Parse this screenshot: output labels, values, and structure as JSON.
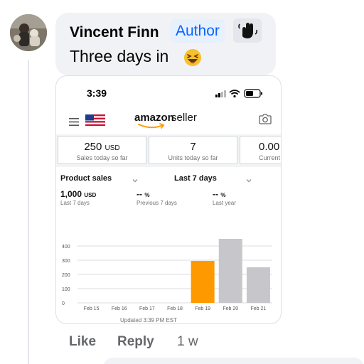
{
  "comment": {
    "author": "Vincent Finn",
    "badge": "Author",
    "text": "Three days in",
    "emoji": "laughing-face-icon"
  },
  "actions": {
    "like": "Like",
    "reply": "Reply",
    "time": "1 w"
  },
  "phone": {
    "status_time": "3:39",
    "logo": {
      "brand": "amazon",
      "suffix": "seller"
    },
    "stats": [
      {
        "value": "250",
        "unit": "USD",
        "caption": "Sales today so far"
      },
      {
        "value": "7",
        "unit": "",
        "caption": "Units today so far"
      },
      {
        "value": "0.00",
        "unit": "",
        "caption": "Current"
      }
    ],
    "selectors": {
      "metric": "Product sales",
      "range": "Last 7 days"
    },
    "metrics": [
      {
        "value": "1,000",
        "unit": "USD",
        "label": "Last 7 days"
      },
      {
        "value": "--",
        "unit": "%",
        "label": "Previous 7 days"
      },
      {
        "value": "--",
        "unit": "%",
        "label": "Last year"
      }
    ],
    "updated": "Updated 3:39 PM EST"
  },
  "colors": {
    "accent": "#0866ff",
    "highlight_bar": "#ff9900",
    "bar": "#c6c6cb"
  },
  "chart_data": {
    "type": "bar",
    "categories": [
      "Feb 15",
      "Feb 16",
      "Feb 17",
      "Feb 18",
      "Feb 19",
      "Feb 20",
      "Feb 21"
    ],
    "values": [
      0,
      0,
      0,
      0,
      295,
      450,
      250
    ],
    "highlight_index": 4,
    "yticks": [
      0,
      100,
      200,
      300,
      400
    ],
    "ylim": [
      0,
      500
    ],
    "grid": true
  }
}
